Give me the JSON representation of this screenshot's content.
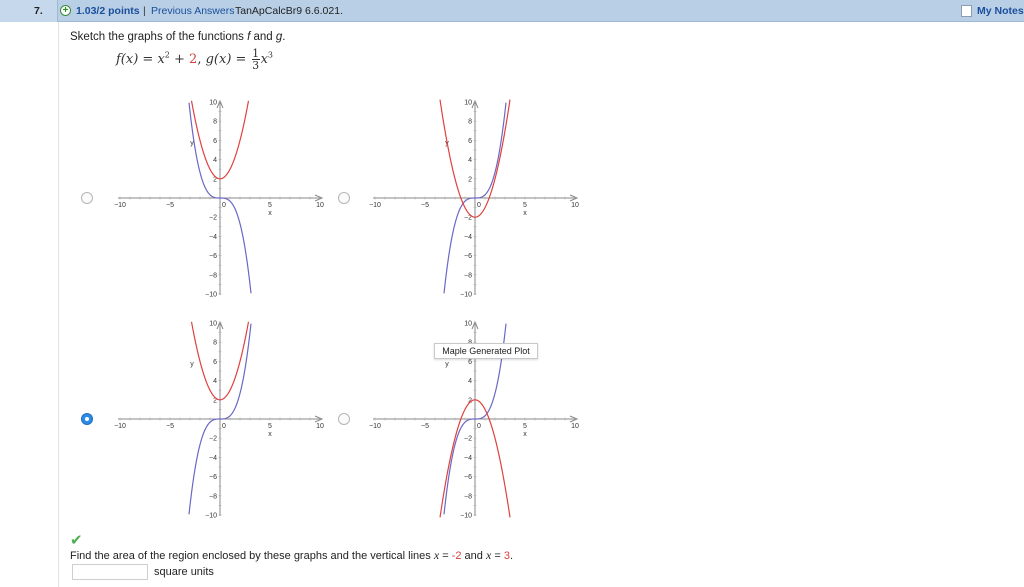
{
  "header": {
    "question_number": "7.",
    "points": "1.03/2 points",
    "separator": "|",
    "previous_answers": "Previous Answers",
    "problem_code": "TanApCalcBr9 6.6.021.",
    "my_notes": "My Notes"
  },
  "prompt": {
    "text_before": "Sketch the graphs of the functions ",
    "f": "f",
    "and": " and ",
    "g": "g",
    "period": ".",
    "formula_f": "f(x) = x",
    "formula_f_exp": "2",
    "formula_plus": " + ",
    "formula_const": "2",
    "formula_comma": ", ",
    "formula_g": "g(x) = ",
    "frac_num": "1",
    "frac_den": "3",
    "formula_x": "x",
    "formula_g_exp": "3"
  },
  "graphs": {
    "axis_labels": {
      "x": "x",
      "y": "y"
    },
    "x_ticks": [
      "−10",
      "−5",
      "0",
      "5",
      "10"
    ],
    "y_ticks_pos": [
      "10",
      "8",
      "6",
      "4",
      "2"
    ],
    "y_ticks_neg": [
      "−2",
      "−4",
      "−6",
      "−8",
      "−10"
    ],
    "colors": {
      "f": "#e0413f",
      "g": "#6a68c6",
      "axis": "#888888"
    },
    "options": [
      {
        "id": "A",
        "selected": false,
        "variant": "g_negated"
      },
      {
        "id": "B",
        "selected": false,
        "variant": "f_shift_down"
      },
      {
        "id": "C",
        "selected": true,
        "variant": "correct"
      },
      {
        "id": "D",
        "selected": false,
        "variant": "f_negated"
      }
    ]
  },
  "tooltip": "Maple Generated Plot",
  "question": {
    "text": "Find the area of the region enclosed by these graphs and the vertical lines ",
    "x1_var": "x",
    "eq1": " = ",
    "x1_val": "-2",
    "and": " and ",
    "x2_var": "x",
    "eq2": " = ",
    "x2_val": "3",
    "end": "."
  },
  "answer": {
    "value": "",
    "units": "square units"
  },
  "check_mark": "✔"
}
